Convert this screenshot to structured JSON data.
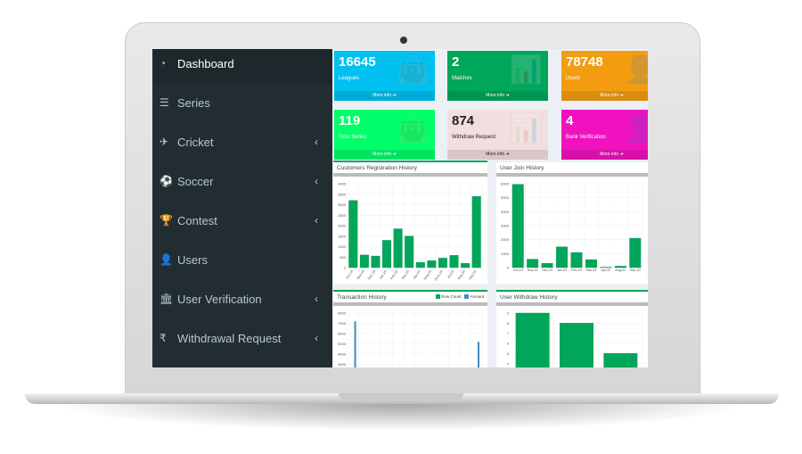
{
  "sidebar": {
    "items": [
      {
        "label": "Dashboard",
        "icon": "dashboard-icon",
        "glyph": "◔",
        "active": true,
        "chevron": false
      },
      {
        "label": "Series",
        "icon": "list-icon",
        "glyph": "☰",
        "chevron": false
      },
      {
        "label": "Cricket",
        "icon": "plane-icon",
        "glyph": "✈",
        "chevron": true
      },
      {
        "label": "Soccer",
        "icon": "soccer-ball-icon",
        "glyph": "⚽",
        "chevron": true
      },
      {
        "label": "Contest",
        "icon": "trophy-icon",
        "glyph": "🏆",
        "chevron": true
      },
      {
        "label": "Users",
        "icon": "user-icon",
        "glyph": "👤",
        "chevron": false
      },
      {
        "label": "User Verification",
        "icon": "bank-icon",
        "glyph": "🏛",
        "chevron": true
      },
      {
        "label": "Withdrawal Request",
        "icon": "rupee-icon",
        "glyph": "₹",
        "chevron": true
      }
    ],
    "chevron_glyph": "‹"
  },
  "cards": [
    {
      "value": "16645",
      "label": "Leagues",
      "more": "More info ➜",
      "color": "#00c0ef",
      "icon": "shopping-bag-icon",
      "glyph": "👜"
    },
    {
      "value": "2",
      "label": "Matches",
      "more": "More info ➜",
      "color": "#00a65a",
      "icon": "bar-chart-icon",
      "glyph": "📊"
    },
    {
      "value": "78748",
      "label": "Users",
      "more": "More info ➜",
      "color": "#f39c12",
      "icon": "user-icon",
      "glyph": "👤"
    },
    {
      "value": "119",
      "label": "Total Series",
      "more": "More info ➜",
      "color": "#00ff6a",
      "icon": "shopping-bag-icon",
      "glyph": "👜"
    },
    {
      "value": "874",
      "label": "Withdraw Request",
      "more": "More info ➜",
      "color": "#f2dede",
      "icon": "bar-chart-icon",
      "glyph": "📊",
      "text_color": "#222"
    },
    {
      "value": "4",
      "label": "Bank Verification",
      "more": "More info ➜",
      "color": "#f012be",
      "icon": "user-icon",
      "glyph": "👤"
    }
  ],
  "chart_data": [
    {
      "type": "bar",
      "title": "Customers Registration History",
      "categories": [
        "Oct,19",
        "Nov,19",
        "Dec,19",
        "Jan,20",
        "Feb,20",
        "Mar,20",
        "Apr,20",
        "May,20",
        "June,20",
        "Jul,20",
        "Aug,20",
        "Sep,20"
      ],
      "values": [
        3200,
        600,
        550,
        1300,
        1850,
        1500,
        250,
        330,
        450,
        580,
        200,
        3400
      ],
      "ylim": [
        0,
        4000
      ],
      "yticks": [
        0,
        500,
        1000,
        1500,
        2000,
        2500,
        3000,
        3500,
        4000
      ],
      "color": "#00a65a",
      "grid": true
    },
    {
      "type": "bar",
      "title": "User Join History",
      "categories": [
        "Oct,19",
        "Nov,19",
        "Dec,19",
        "Jan,20",
        "Feb,20",
        "Mar,20",
        "Apr,20",
        "Aug,20",
        "Sep,20"
      ],
      "values": [
        5950,
        600,
        300,
        1480,
        1080,
        570,
        30,
        100,
        2100
      ],
      "ylim": [
        0,
        6000
      ],
      "yticks": [
        0,
        1000,
        2000,
        3000,
        4000,
        5000,
        6000
      ],
      "color": "#00a65a",
      "grid": true
    },
    {
      "type": "bar",
      "title": "Transaction History",
      "series": [
        {
          "name": "Row Count",
          "color": "#00a65a",
          "values": []
        },
        {
          "name": "Amount",
          "color": "#3c8dbc",
          "values": [
            7200,
            5200
          ]
        }
      ],
      "ylim": [
        0,
        8000
      ],
      "yticks": [
        3000,
        4000,
        5000,
        6000,
        7000,
        8000
      ],
      "grid": true,
      "legend": "top-right"
    },
    {
      "type": "bar",
      "title": "User Withdraw History",
      "values": [
        9,
        8,
        5
      ],
      "ylim": [
        0,
        9
      ],
      "yticks": [
        4,
        5,
        6,
        7,
        8,
        9
      ],
      "color": "#00a65a",
      "grid": true
    }
  ]
}
